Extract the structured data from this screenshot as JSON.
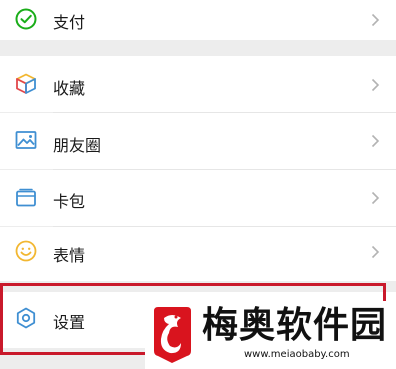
{
  "menu": {
    "pay_label": "支付",
    "favorites_label": "收藏",
    "moments_label": "朋友圈",
    "cards_label": "卡包",
    "stickers_label": "表情",
    "settings_label": "设置"
  },
  "watermark": {
    "title": "梅奥软件园",
    "url": "www.meiaobaby.com"
  },
  "colors": {
    "highlight": "#c9192b",
    "pay_icon": "#1aad19",
    "icon_blue": "#3f8fd2",
    "icon_yellow": "#f2b731"
  },
  "icons": [
    "wallet-icon",
    "cube-icon",
    "image-icon",
    "card-icon",
    "smile-icon",
    "gear-icon",
    "chevron-right-icon"
  ]
}
